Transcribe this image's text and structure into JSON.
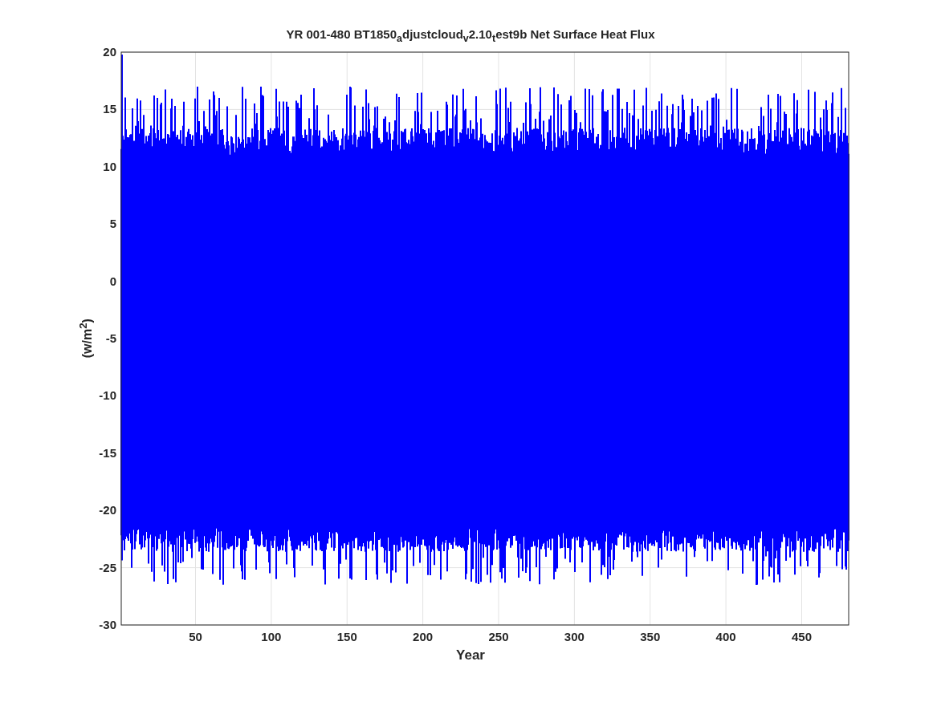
{
  "plot": {
    "title": "YR 001-480 BT1850$_{a}$djustcloud$_{v}$2.10$_{t}$est9b Net Surface Heat Flux",
    "xlabel": "Year",
    "ylabel": "(w/m$^{2}$)",
    "xticks": [
      "50",
      "100",
      "150",
      "200",
      "250",
      "300",
      "350",
      "400",
      "450"
    ],
    "yticks": [
      "20",
      "15",
      "10",
      "5",
      "0",
      "-5",
      "-10",
      "-15",
      "-20",
      "-25",
      "-30"
    ]
  }
}
